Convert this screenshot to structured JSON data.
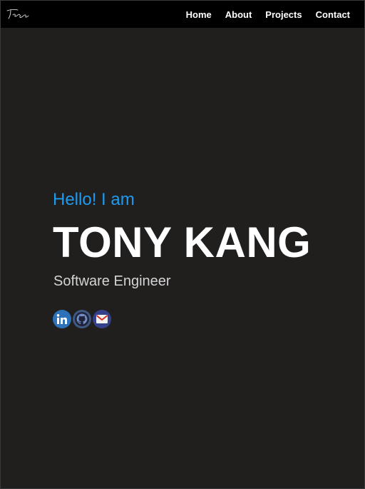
{
  "navbar": {
    "logo_alt": "Tony Kang signature logo",
    "links": [
      "Home",
      "About",
      "Projects",
      "Contact"
    ]
  },
  "hero": {
    "greeting": "Hello! I am",
    "name": "TONY KANG",
    "role": "Software Engineer"
  },
  "socials": [
    {
      "name": "linkedin",
      "icon": "linkedin-icon"
    },
    {
      "name": "github",
      "icon": "github-icon"
    },
    {
      "name": "email",
      "icon": "email-icon"
    }
  ],
  "colors": {
    "background": "#201f1e",
    "navbar": "#000000",
    "accent": "#1d9bf0",
    "text": "#ffffff",
    "muted": "#d4d4d4"
  }
}
